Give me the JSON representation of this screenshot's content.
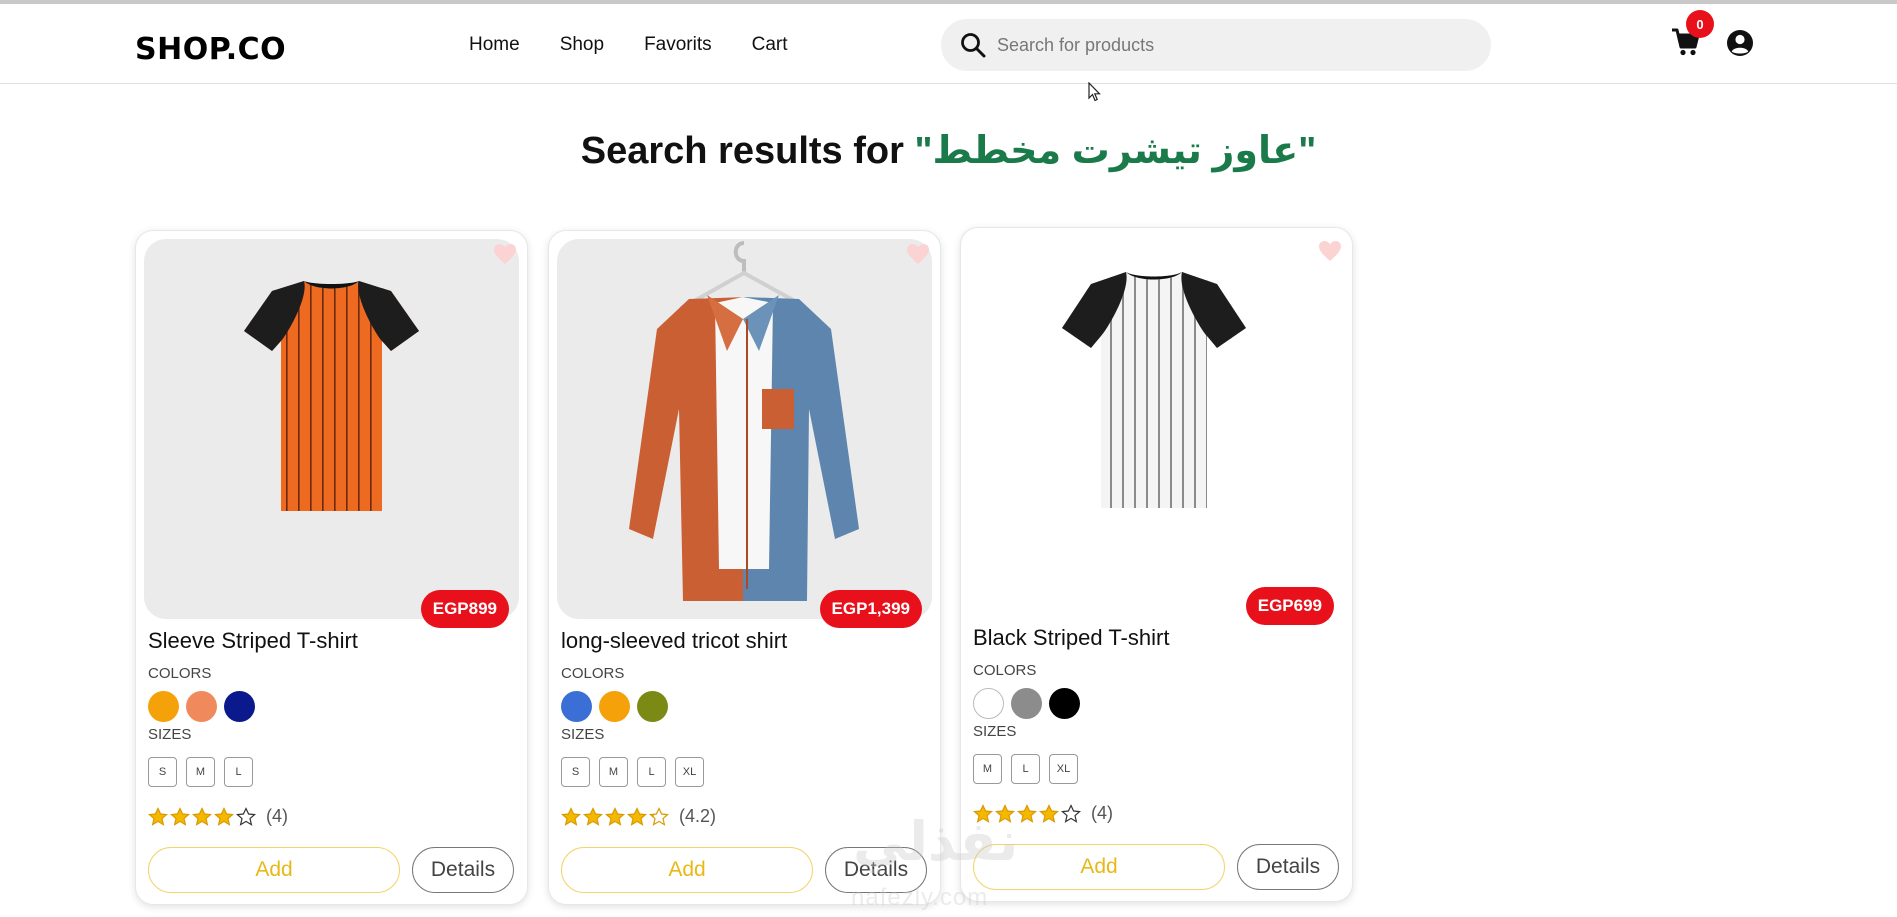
{
  "header": {
    "logo": "SHOP.CO",
    "nav": [
      "Home",
      "Shop",
      "Favorits",
      "Cart"
    ],
    "search_placeholder": "Search for products",
    "cart_count": "0"
  },
  "results": {
    "prefix": "Search results for ",
    "query": "\"عاوز تيشرت مخطط\""
  },
  "labels": {
    "colors": "COLORS",
    "sizes": "SIZES",
    "add": "Add",
    "details": "Details"
  },
  "products": [
    {
      "title": "Sleeve Striped T-shirt",
      "price": "EGP899",
      "image": "orange-striped-raglan-tshirt",
      "colors": [
        "#f5a10a",
        "#f08a5d",
        "#0a1a8c"
      ],
      "sizes": [
        "S",
        "M",
        "L"
      ],
      "rating": 4,
      "rating_label": "(4)"
    },
    {
      "title": "long-sleeved tricot shirt",
      "price": "EGP1,399",
      "image": "two-tone-long-sleeve-shirt-on-hanger",
      "colors": [
        "#3b6fd6",
        "#f5a10a",
        "#7b8a14"
      ],
      "sizes": [
        "S",
        "M",
        "L",
        "XL"
      ],
      "rating": 4.2,
      "rating_label": "(4.2)"
    },
    {
      "title": "Black Striped T-shirt",
      "price": "EGP699",
      "image": "black-white-striped-raglan-tshirt",
      "colors": [
        "#ffffff",
        "#8c8c8c",
        "#000000"
      ],
      "sizes": [
        "M",
        "L",
        "XL"
      ],
      "rating": 4,
      "rating_label": "(4)"
    }
  ],
  "watermark": {
    "mark": "نفذلي",
    "url": "nafezly.com"
  },
  "colors": {
    "price_badge": "#e8111b",
    "query_text": "#1b7a4a",
    "star": "#f5b800",
    "add_button": "#e8b817"
  }
}
